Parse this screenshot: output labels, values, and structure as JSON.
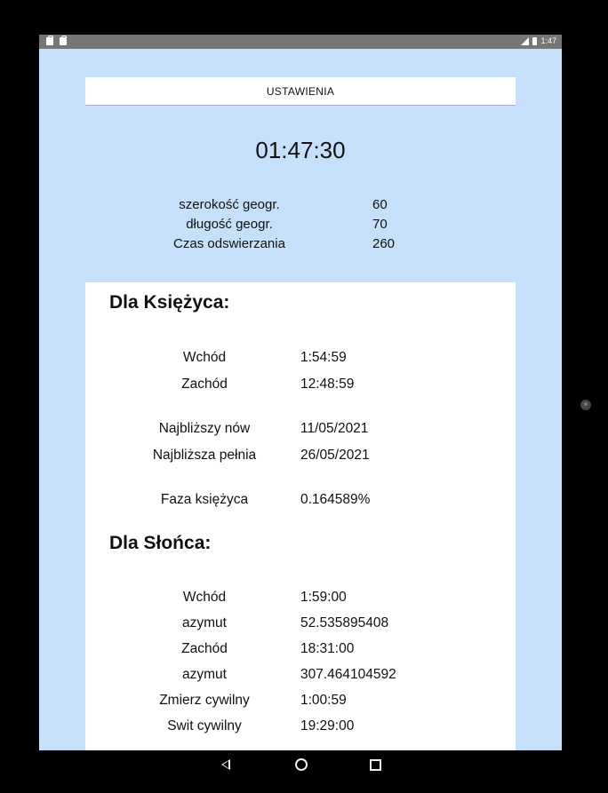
{
  "status": {
    "time": "1:47"
  },
  "settings_button": "USTAWIENIA",
  "clock": "01:47:30",
  "params": [
    {
      "label": "szerokość geogr.",
      "value": "60"
    },
    {
      "label": "długość geogr.",
      "value": "70"
    },
    {
      "label": "Czas odswierzania",
      "value": "260"
    }
  ],
  "moon": {
    "title": "Dla Księżyca:",
    "rows": [
      {
        "label": "Wchód",
        "value": "1:54:59"
      },
      {
        "label": "Zachód",
        "value": "12:48:59"
      },
      {
        "label": "Najbliższy nów",
        "value": "11/05/2021"
      },
      {
        "label": "Najbliższa pełnia",
        "value": "26/05/2021"
      },
      {
        "label": "Faza księżyca",
        "value": "0.164589%"
      }
    ]
  },
  "sun": {
    "title": "Dla Słońca:",
    "rows": [
      {
        "label": "Wchód",
        "value": "1:59:00"
      },
      {
        "label": "azymut",
        "value": "52.535895408"
      },
      {
        "label": "Zachód",
        "value": "18:31:00"
      },
      {
        "label": "azymut",
        "value": "307.464104592"
      },
      {
        "label": "Zmierz cywilny",
        "value": "1:00:59"
      },
      {
        "label": "Swit cywilny",
        "value": "19:29:00"
      }
    ]
  }
}
